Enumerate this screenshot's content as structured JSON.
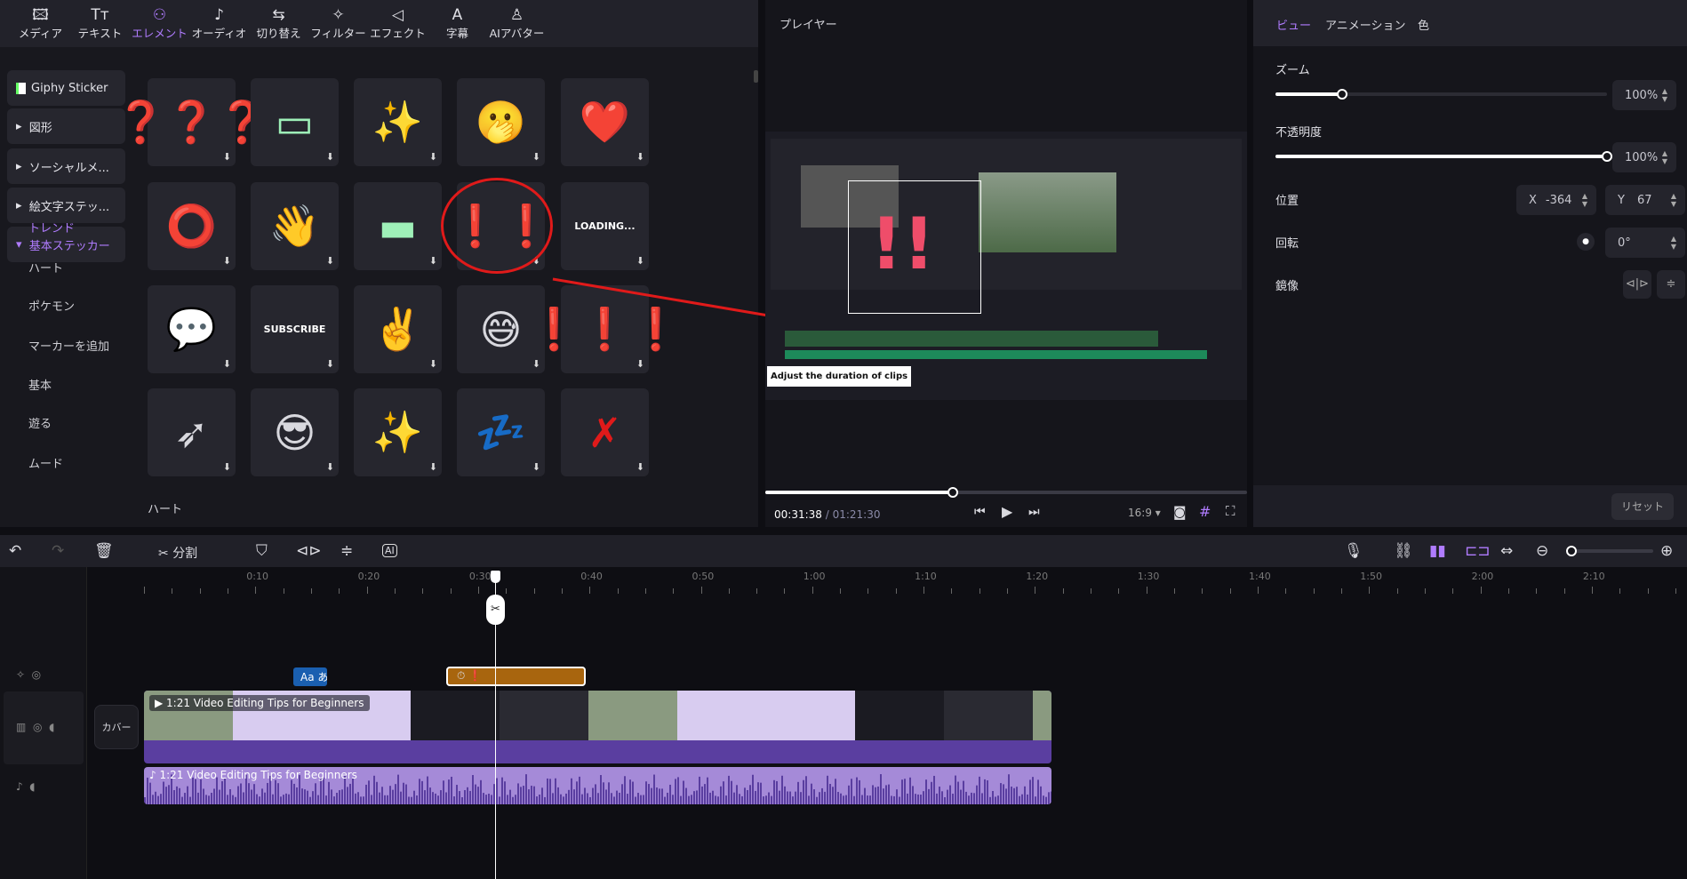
{
  "toolbar": {
    "items": [
      {
        "label": "メディア",
        "icon": "media-icon",
        "glyph": "🖾"
      },
      {
        "label": "テキスト",
        "icon": "text-icon",
        "glyph": "Tт"
      },
      {
        "label": "エレメント",
        "icon": "element-icon",
        "glyph": "⚇",
        "active": true
      },
      {
        "label": "オーディオ",
        "icon": "audio-icon",
        "glyph": "♪"
      },
      {
        "label": "切り替え",
        "icon": "transition-icon",
        "glyph": "⇆"
      },
      {
        "label": "フィルター",
        "icon": "filter-icon",
        "glyph": "✧"
      },
      {
        "label": "エフェクト",
        "icon": "effect-icon",
        "glyph": "◁"
      },
      {
        "label": "字幕",
        "icon": "subtitle-icon",
        "glyph": "A"
      },
      {
        "label": "AIアバター",
        "icon": "avatar-icon",
        "glyph": "♙"
      }
    ]
  },
  "sidebar": {
    "categories": [
      "Giphy Sticker",
      "図形",
      "ソーシャルメ...",
      "絵文字ステッ...",
      "基本ステッカー"
    ],
    "subitems": [
      "トレンド",
      "ハート",
      "ポケモン",
      "マーカーを追加",
      "基本",
      "遊る",
      "ムード"
    ]
  },
  "stickers": {
    "cells": [
      "❓❓❓",
      "▭",
      "✨",
      "🫢",
      "❤️",
      "⭕",
      "👋",
      "▬",
      "❗❗",
      "LOADING...",
      "💬",
      "SUBSCRIBE",
      "✌️",
      "😅",
      "❗❗❗",
      "➶",
      "😎",
      "✨",
      "💤",
      "✗"
    ],
    "section_label": "ハート"
  },
  "player": {
    "title": "プレイヤー",
    "current_time": "00:31:38",
    "total_time": "01:21:30",
    "progress": 0.39,
    "aspect": "16:9",
    "inner_caption": "Adjust the duration of clips"
  },
  "props": {
    "tabs": [
      "ビュー",
      "アニメーション",
      "色"
    ],
    "zoom_label": "ズーム",
    "zoom_value": "100%",
    "zoom_level": 0.2,
    "opacity_label": "不透明度",
    "opacity_value": "100%",
    "opacity_level": 1.0,
    "position_label": "位置",
    "x_label": "X",
    "x_value": "-364",
    "y_label": "Y",
    "y_value": "67",
    "rotation_label": "回転",
    "rotation_value": "0°",
    "mirror_label": "鏡像",
    "reset": "リセット"
  },
  "timeline": {
    "split_label": "分割",
    "cover_label": "カバー",
    "ruler": [
      "0:10",
      "0:20",
      "0:30",
      "0:40",
      "0:50",
      "1:00",
      "1:10",
      "1:20",
      "1:30",
      "1:40",
      "1:50",
      "2:00",
      "2:10"
    ],
    "video_clip_title": "1:21 Video Editing Tips for Beginners",
    "audio_clip_title": "1:21 Video Editing Tips for Beginners",
    "text_clip": "Aa あ",
    "accent": "#b07cff",
    "video_color": "#5a3ea0",
    "sticker_color": "#a8650e"
  }
}
